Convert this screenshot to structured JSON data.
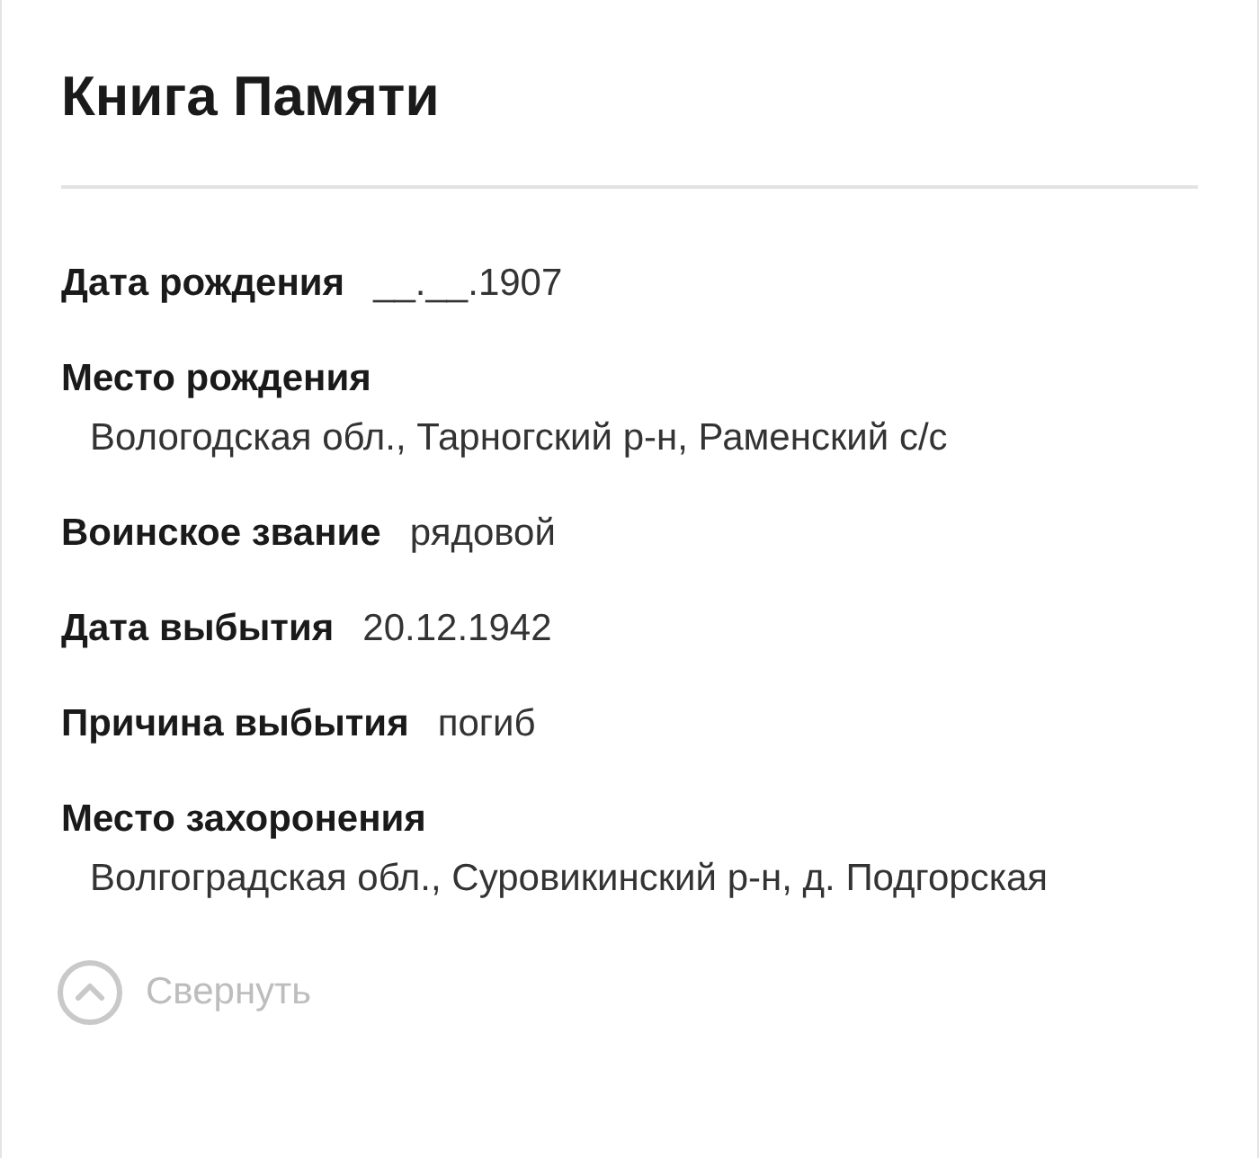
{
  "title": "Книга Памяти",
  "fields": [
    {
      "kind": "inline",
      "label": "Дата рождения",
      "value": "__.__.1907"
    },
    {
      "kind": "block",
      "label": "Место рождения",
      "value": "Вологодская обл., Тарногский р-н, Раменский с/с"
    },
    {
      "kind": "inline",
      "label": "Воинское звание",
      "value": "рядовой"
    },
    {
      "kind": "inline",
      "label": "Дата выбытия",
      "value": "20.12.1942"
    },
    {
      "kind": "inline",
      "label": "Причина выбытия",
      "value": "погиб"
    },
    {
      "kind": "block",
      "label": "Место захоронения",
      "value": "Волгоградская обл., Суровикинский р-н, д. Подгорская"
    }
  ],
  "collapse": {
    "label": "Свернуть"
  }
}
